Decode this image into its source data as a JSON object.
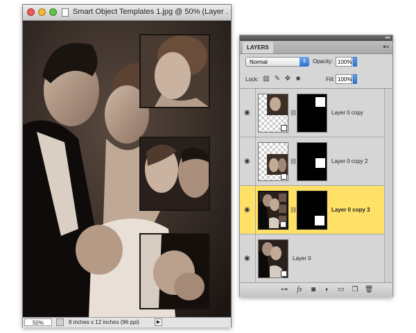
{
  "document_window": {
    "title": "Smart Object Templates 1.jpg @ 50% (Layer ...",
    "zoom": "50%",
    "doc_size": "8 inches x 12 inches (96 ppi)",
    "traffic_lights": {
      "close": "#ee5a55",
      "minimize": "#f3b93b",
      "zoom": "#5fc24a"
    }
  },
  "layers_panel": {
    "tab_label": "LAYERS",
    "blend_mode": "Normal",
    "opacity_label": "Opacity:",
    "opacity_value": "100%",
    "lock_label": "Lock:",
    "fill_label": "Fill:",
    "fill_value": "100%",
    "selection_color": "#ffe168",
    "layers": [
      {
        "name": "Layer 0 copy",
        "visible": true,
        "selected": false
      },
      {
        "name": "Layer 0 copy 2",
        "visible": true,
        "selected": false
      },
      {
        "name": "Layer 0 copy 3",
        "visible": true,
        "selected": true
      },
      {
        "name": "Layer 0",
        "visible": true,
        "selected": false
      }
    ],
    "bottom_icons": [
      "link-layers-icon",
      "fx-icon",
      "add-mask-icon",
      "adjustment-layer-icon",
      "new-group-icon",
      "new-layer-icon",
      "trash-icon"
    ]
  }
}
